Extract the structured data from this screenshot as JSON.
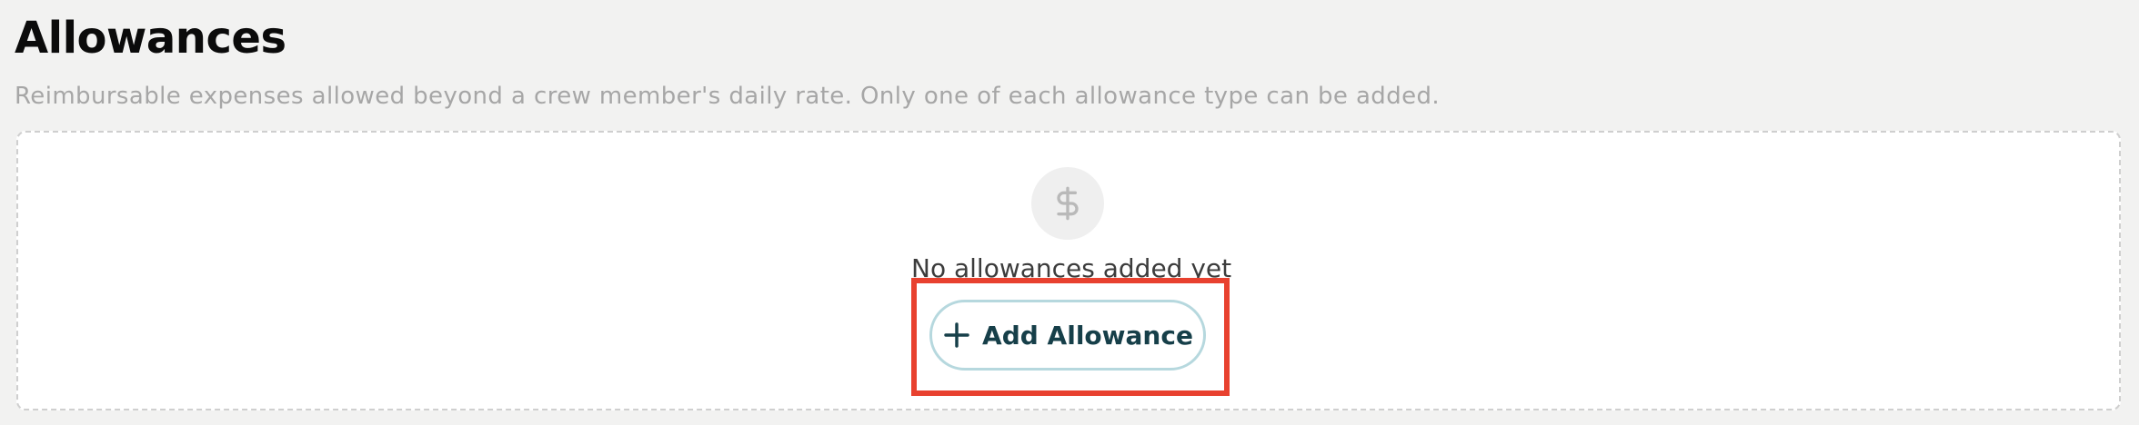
{
  "section": {
    "title": "Allowances",
    "description": "Reimbursable expenses allowed beyond a crew member's daily rate. Only one of each allowance type can be added."
  },
  "empty_state": {
    "icon": "dollar-sign-icon",
    "message": "No allowances added yet",
    "add_button_label": "Add Allowance",
    "add_button_icon": "plus-icon"
  },
  "colors": {
    "highlight": "#e8412f",
    "button_border": "#b6d8de",
    "button_text": "#163f49"
  }
}
